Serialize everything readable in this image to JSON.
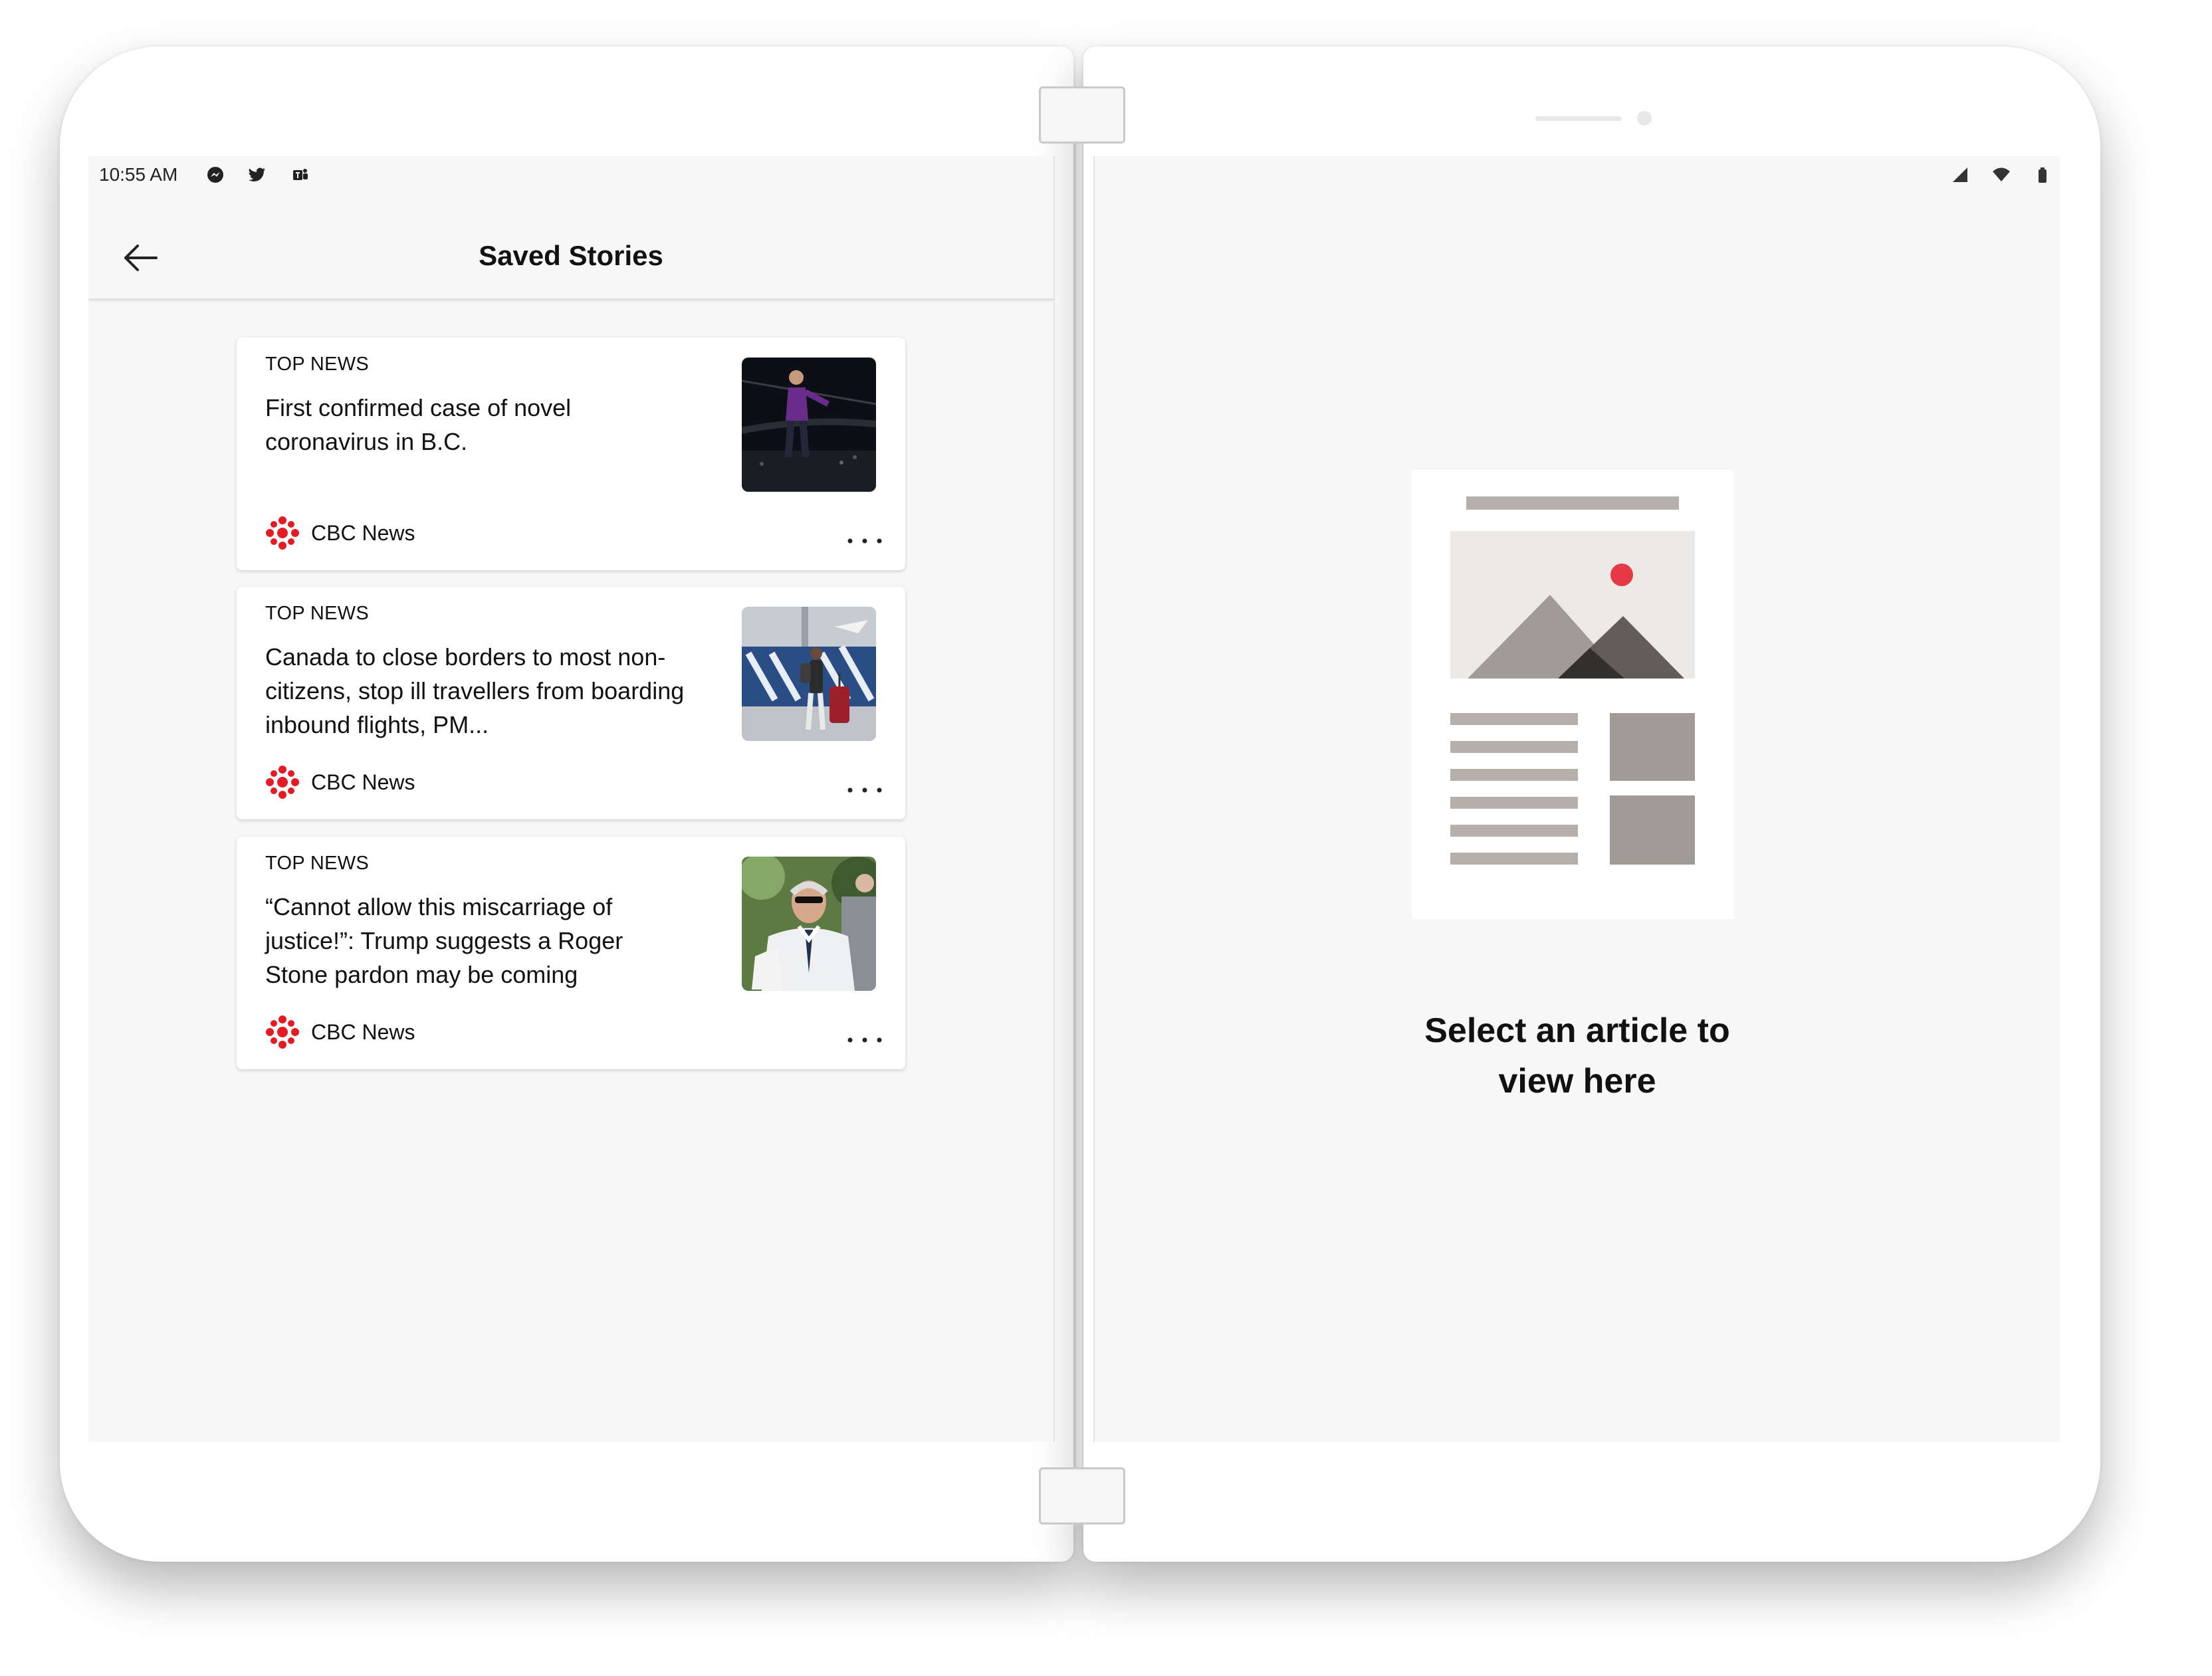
{
  "status_bar": {
    "time": "10:55 AM",
    "notification_icons": [
      "messenger-icon",
      "twitter-icon",
      "teams-icon"
    ],
    "system_icons": [
      "signal-icon",
      "wifi-icon",
      "battery-icon"
    ]
  },
  "app_bar": {
    "back_icon": "back-arrow-icon",
    "title": "Saved Stories"
  },
  "stories": [
    {
      "category": "TOP NEWS",
      "headline": "First confirmed case of novel coronavirus in B.C.",
      "source": "CBC News",
      "thumbnail": "photo-performer-on-stage"
    },
    {
      "category": "TOP NEWS",
      "headline": "Canada to close borders to most non-citizens, stop ill travellers from boarding inbound flights, PM...",
      "source": "CBC News",
      "thumbnail": "photo-traveller-at-airport"
    },
    {
      "category": "TOP NEWS",
      "headline": "“Cannot allow this miscarriage of justice!”: Trump suggests a Roger Stone pardon may be coming",
      "source": "CBC News",
      "thumbnail": "photo-man-in-white-suit"
    }
  ],
  "detail_pane": {
    "illustration": "article-placeholder-illustration",
    "message_line1": "Select an article to",
    "message_line2": "view here"
  },
  "colors": {
    "brand_red": "#e51b24",
    "screen_bg": "#f7f7f7",
    "illustration_gray": "#a19b97",
    "illustration_accent": "#e63946"
  }
}
